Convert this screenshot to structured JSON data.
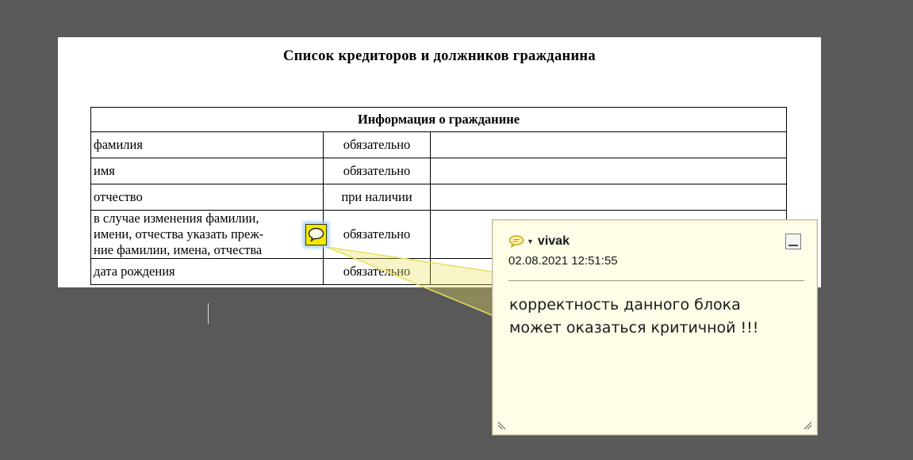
{
  "document": {
    "title": "Список кредиторов и должников гражданина",
    "table": {
      "header": "Информация о гражданине",
      "rows": [
        {
          "field": "фамилия",
          "requirement": "обязательно",
          "value": ""
        },
        {
          "field": "имя",
          "requirement": "обязательно",
          "value": ""
        },
        {
          "field": "отчество",
          "requirement": "при наличии",
          "value": ""
        },
        {
          "field_lines": [
            "в случае изменения фамилии,",
            "имени, отчества указать преж-",
            "ние фамилии, имена, отчества"
          ],
          "requirement": "обязательно",
          "value": ""
        },
        {
          "field": "дата рождения",
          "requirement": "обязательно",
          "value": ""
        }
      ]
    }
  },
  "annotation": {
    "icon": "comment-icon",
    "author": "vivak",
    "timestamp": "02.08.2021 12:51:55",
    "text_lines": [
      "корректность данного блока",
      "может оказаться критичной !!!"
    ]
  },
  "colors": {
    "workspace": "#595959",
    "note_background": "#fffde8",
    "marker": "#f5e900",
    "connector": "#e8e060"
  }
}
